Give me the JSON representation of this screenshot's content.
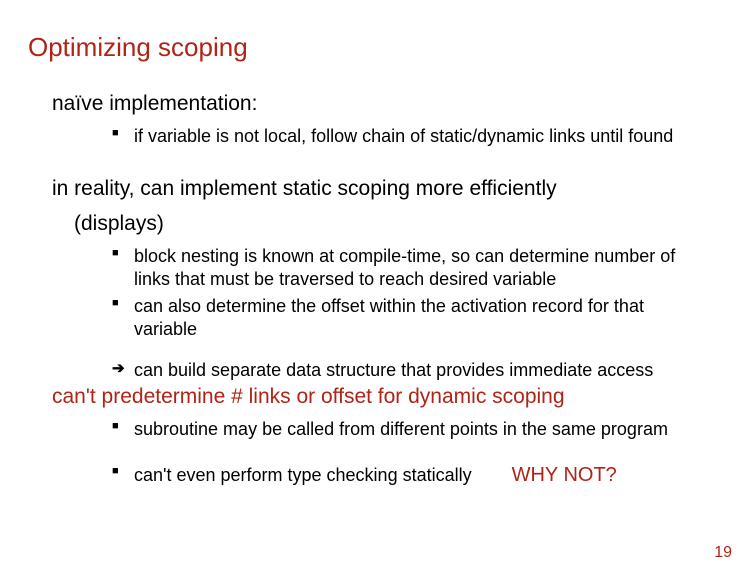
{
  "title": "Optimizing scoping",
  "section1": {
    "heading": "naïve implementation:",
    "bullets": [
      "if variable is not local, follow chain of static/dynamic links until found"
    ]
  },
  "section2": {
    "heading_line1": "in reality, can implement static scoping more efficiently",
    "heading_line2": "(displays)",
    "bullets": [
      "block nesting is known at compile-time, so can determine number of links that must be traversed to reach desired variable",
      "can also determine the offset within the activation record for that variable"
    ],
    "arrow": "can build separate data structure that provides immediate access"
  },
  "section3": {
    "heading": "can't predetermine # links or offset for dynamic scoping",
    "bullets": [
      "subroutine may be called from different points in the same program",
      "can't even perform type checking statically"
    ],
    "whynot": "WHY NOT?"
  },
  "page_number": "19"
}
